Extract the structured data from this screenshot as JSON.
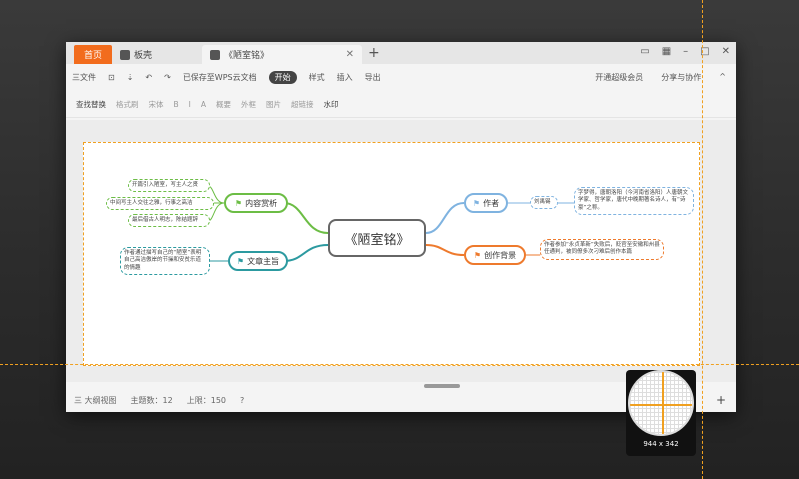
{
  "tabs": {
    "home": "首页",
    "layer": "板壳",
    "doc": "《陋室铭》"
  },
  "menu": {
    "file": "三文件",
    "saved": "已保存至WPS云文档",
    "start": "开始",
    "style": "样式",
    "insert": "插入",
    "export": "导出",
    "member": "开通超级会员",
    "share": "分享与协作"
  },
  "toolbar": [
    "查找替换",
    "格式刷",
    "宋体",
    "B",
    "I",
    "A",
    "概要",
    "外框",
    "图片",
    "超链接",
    "水印"
  ],
  "root": "《陋室铭》",
  "branches": {
    "content": "内容赏析",
    "theme": "文章主旨",
    "author": "作者",
    "background": "创作背景"
  },
  "leaves": {
    "c1": "开篇引入陋室，写主人之贤",
    "c2": "中间写主人交往之雅，行事之高洁",
    "c3": "最后借古人明志，陈结题辞",
    "t1": "作者通过描写自己的“陋室”表明自己高洁傲岸的节操和安贫乐道的情趣",
    "a1": "刘禹锡",
    "a2": "字梦得，唐朝洛阳（今河南省洛阳）人唐朝文学家、哲学家，唐代中晚期著名诗人，有“诗豪”之称。",
    "b1": "作者参加“永贞革新”失败后，贬官至安徽和州县任通判，被同僚多次刁难后创作本篇"
  },
  "status": {
    "outline": "三 大纲视图",
    "topics": "主题数：12",
    "limit": "上限：150"
  },
  "magnifier": "944 x 342"
}
